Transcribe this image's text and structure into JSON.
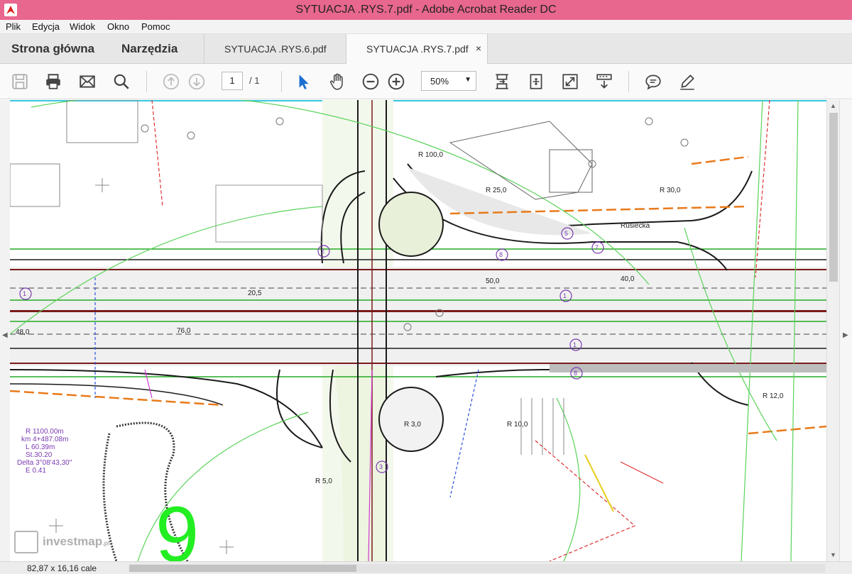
{
  "window": {
    "title": "SYTUACJA .RYS.7.pdf - Adobe Acrobat Reader DC"
  },
  "menu": {
    "items": [
      "Plik",
      "Edycja",
      "Widok",
      "Okno",
      "Pomoc"
    ]
  },
  "tabs": {
    "home": "Strona główna",
    "tools": "Narzędzia",
    "docs": [
      {
        "label": "SYTUACJA .RYS.6.pdf"
      },
      {
        "label": "SYTUACJA .RYS.7.pdf",
        "close": "×"
      }
    ]
  },
  "toolbar": {
    "page_current": "1",
    "page_total": "/ 1",
    "zoom": "50%",
    "icons": [
      "save-icon",
      "print-icon",
      "email-icon",
      "search-icon",
      "page-up-icon",
      "page-down-icon",
      "select-cursor-icon",
      "hand-tool-icon",
      "zoom-out-icon",
      "zoom-in-icon",
      "fit-page-icon",
      "rotate-icon",
      "full-screen-icon",
      "scroll-mode-icon",
      "comment-icon",
      "sign-pen-icon"
    ]
  },
  "drawing": {
    "labels": {
      "road_name": "Rusiecka",
      "curve_lines": [
        "R 1100.00m",
        "km 4+487.08m",
        "L 60.39m",
        "St.30.20",
        "Delta 3°08'43,30\"",
        "E 0.41"
      ],
      "dim_1": "20,5",
      "dim_2": "40,0",
      "dim_3": "50,0",
      "dim_4": "76,0",
      "dim_5": "48,0",
      "big_number": "9",
      "r_labels": [
        "R 100,0",
        "R 25,0",
        "R 30,0",
        "R 12,0",
        "R 5,0",
        "R 3,0",
        "R 10,0"
      ],
      "circle_numbers": [
        "1",
        "1",
        "1",
        "5",
        "8",
        "8",
        "7",
        "2",
        "3"
      ]
    }
  },
  "watermark": {
    "text": "investmap",
    "suffix": ".pl"
  },
  "status": {
    "page_dims": "82,87 x 16,16 cale"
  }
}
